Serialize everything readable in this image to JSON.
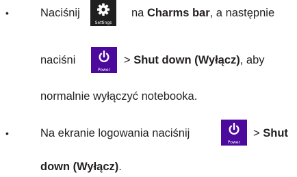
{
  "bullets": {
    "first": {
      "marker": "•",
      "text1": "Naciśnij",
      "settings_tile_label": "Settings",
      "text2": "na ",
      "charms_bar": "Charms bar",
      "text3": ", a następnie",
      "text4": "naciśni",
      "power_tile_label": "Power",
      "text5": "> ",
      "shut_down": "Shut down (Wyłącz)",
      "text6": ", aby",
      "text7": "normalnie wyłączyć notebooka."
    },
    "second": {
      "marker": "•",
      "text1": "Na ekranie logowania naciśnij",
      "power_tile_label": "Power",
      "text2": "> ",
      "shut": "Shut",
      "shut_down_rest": "down (Wyłącz)",
      "text3": "."
    }
  },
  "colors": {
    "power_tile": "#4b0a9c",
    "settings_tile": "#1f1f1f",
    "text": "#231f20"
  },
  "icons": {
    "settings": "gear-icon",
    "power": "power-icon"
  }
}
